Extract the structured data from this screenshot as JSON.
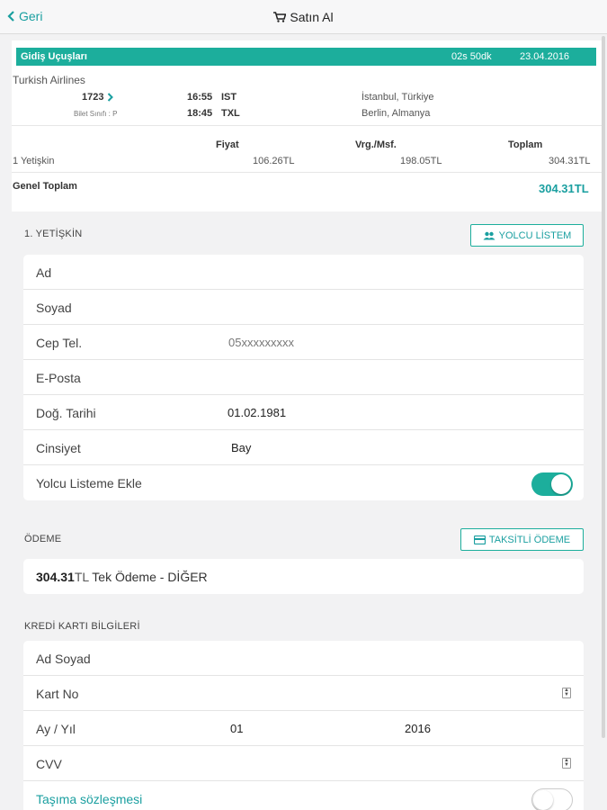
{
  "nav": {
    "back": "Geri",
    "title": "Satın Al"
  },
  "flight": {
    "bar_title": "Gidiş Uçuşları",
    "duration": "02s 50dk",
    "date": "23.04.2016",
    "airline": "Turkish Airlines",
    "flight_no": "1723",
    "ticket_class": "Bilet Sınıfı : P",
    "dep_time": "16:55",
    "dep_code": "IST",
    "arr_time": "18:45",
    "arr_code": "TXL",
    "dep_city": "İstanbul, Türkiye",
    "arr_city": "Berlin, Almanya"
  },
  "price": {
    "headers": {
      "fiyat": "Fiyat",
      "vergi": "Vrg./Msf.",
      "toplam": "Toplam"
    },
    "row": {
      "label": "1 Yetişkin",
      "fiyat": "106.26TL",
      "vergi": "198.05TL",
      "toplam": "304.31TL"
    },
    "grand_label": "Genel Toplam",
    "grand_value": "304.31TL"
  },
  "passenger": {
    "section": "1. YETİŞKİN",
    "list_button": "YOLCU LİSTEM",
    "fields": [
      {
        "label": "Ad",
        "value": ""
      },
      {
        "label": "Soyad",
        "value": ""
      },
      {
        "label": "Cep Tel.",
        "value": "05xxxxxxxxx"
      },
      {
        "label": "E-Posta",
        "value": ""
      },
      {
        "label": "Doğ. Tarihi",
        "value": "01.02.1981"
      },
      {
        "label": "Cinsiyet",
        "value": "Bay"
      }
    ],
    "add_to_list": "Yolcu Listeme Ekle",
    "add_to_list_on": true
  },
  "payment": {
    "section": "ÖDEME",
    "installment_button": "TAKSİTLİ ÖDEME",
    "amount": "304.31",
    "currency": "TL",
    "desc": "Tek Ödeme - DİĞER"
  },
  "card": {
    "section": "KREDİ KARTI BİLGİLERİ",
    "name_label": "Ad Soyad",
    "number_label": "Kart No",
    "expiry_label": "Ay / Yıl",
    "month": "01",
    "year": "2016",
    "cvv_label": "CVV",
    "contract_link": "Taşıma sözleşmesi"
  },
  "colors": {
    "accent": "#1cae9c",
    "link": "#1a9fa0"
  }
}
